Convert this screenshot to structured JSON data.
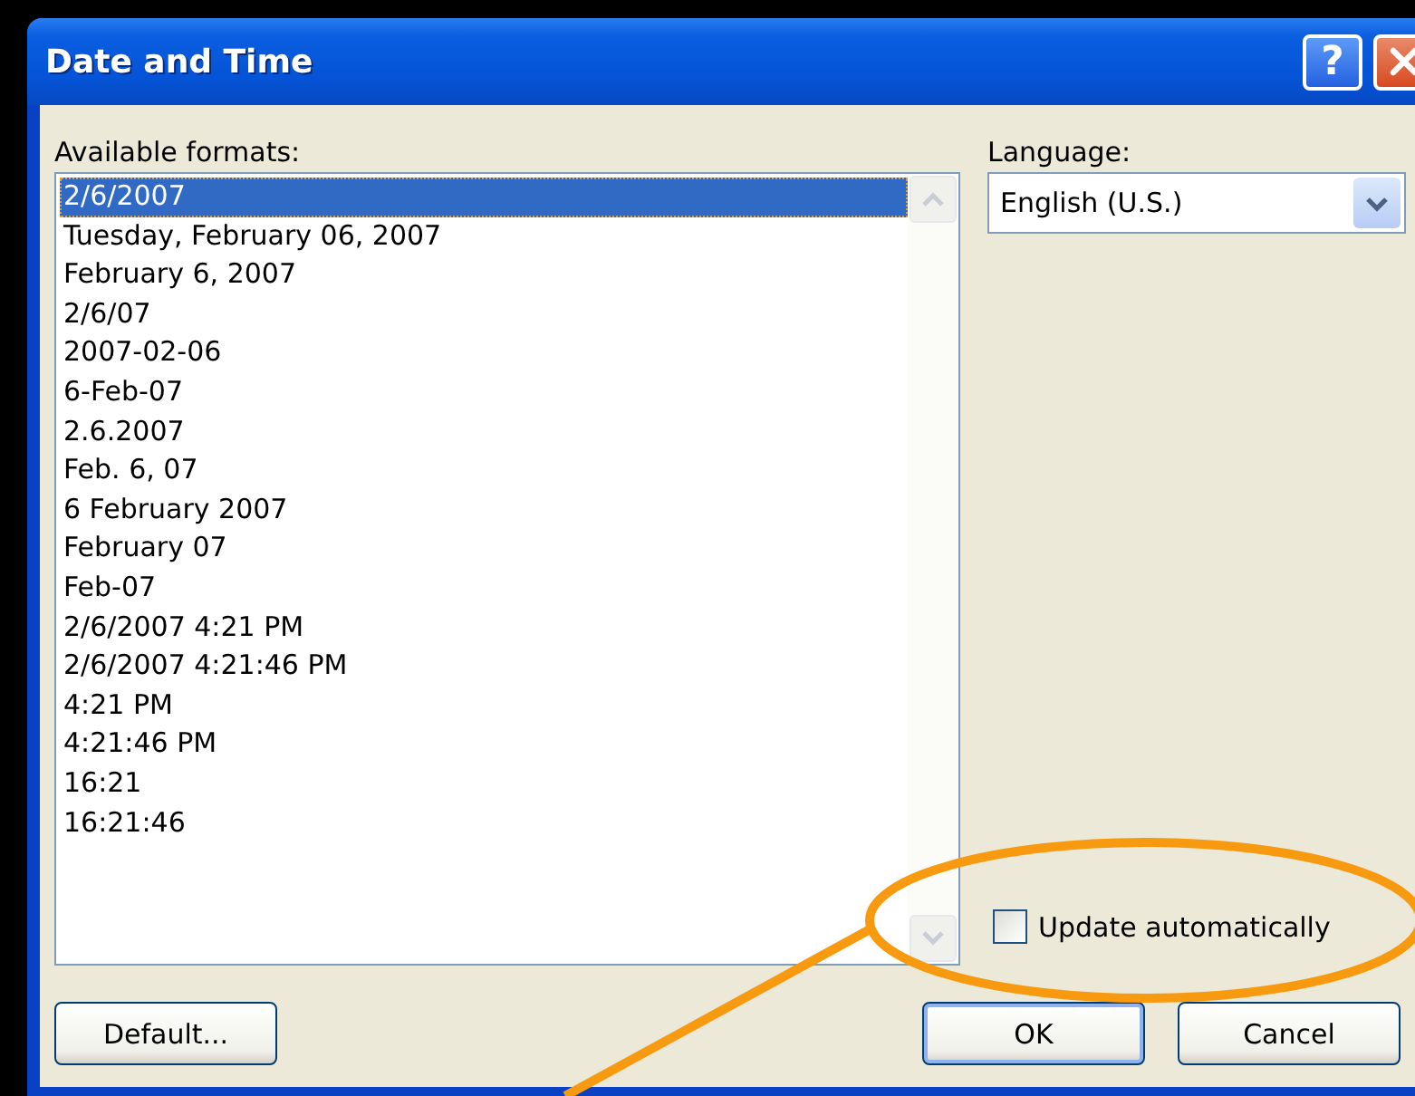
{
  "window": {
    "title": "Date and Time",
    "help_button": "?"
  },
  "formats": {
    "label": "Available formats:",
    "items": [
      {
        "text": "2/6/2007",
        "selected": true
      },
      {
        "text": "Tuesday, February 06, 2007",
        "selected": false
      },
      {
        "text": "February 6, 2007",
        "selected": false
      },
      {
        "text": "2/6/07",
        "selected": false
      },
      {
        "text": "2007-02-06",
        "selected": false
      },
      {
        "text": "6-Feb-07",
        "selected": false
      },
      {
        "text": "2.6.2007",
        "selected": false
      },
      {
        "text": "Feb. 6, 07",
        "selected": false
      },
      {
        "text": "6 February 2007",
        "selected": false
      },
      {
        "text": "February 07",
        "selected": false
      },
      {
        "text": "Feb-07",
        "selected": false
      },
      {
        "text": "2/6/2007 4:21 PM",
        "selected": false
      },
      {
        "text": "2/6/2007 4:21:46 PM",
        "selected": false
      },
      {
        "text": "4:21 PM",
        "selected": false
      },
      {
        "text": "4:21:46 PM",
        "selected": false
      },
      {
        "text": "16:21",
        "selected": false
      },
      {
        "text": "16:21:46",
        "selected": false
      }
    ]
  },
  "language": {
    "label": "Language:",
    "value": "English (U.S.)"
  },
  "update_automatically": {
    "label": "Update automatically",
    "checked": false
  },
  "buttons": [
    {
      "label": "Default...",
      "kind": "left"
    },
    {
      "label": "OK",
      "kind": "default"
    },
    {
      "label": "Cancel",
      "kind": "normal"
    }
  ]
}
